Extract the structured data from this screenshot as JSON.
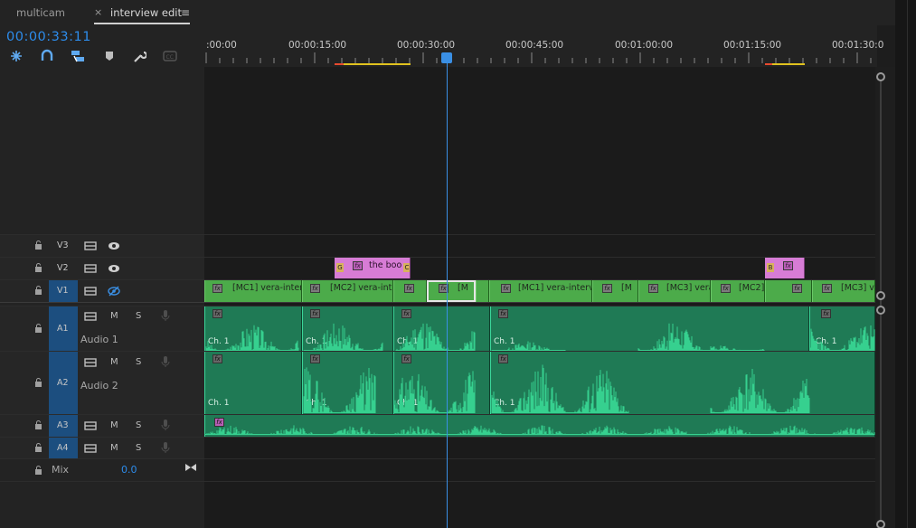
{
  "tabs": {
    "inactive": "multicam",
    "close_glyph": "×",
    "active": "interview edit",
    "menu_glyph": "≡"
  },
  "timecode": "00:00:33:11",
  "toolbar": {
    "icons": [
      "insert-nest-icon",
      "snap-magnet-icon",
      "linked-selection-icon",
      "add-marker-icon",
      "settings-wrench-icon",
      "captions-icon"
    ]
  },
  "ruler": {
    "labels": [
      ":00:00",
      "00:00:15:00",
      "00:00:30:00",
      "00:00:45:00",
      "00:01:00:00",
      "00:01:15:00",
      "00:01:30:0"
    ]
  },
  "tracks": {
    "v3": {
      "name": "V3"
    },
    "v2": {
      "name": "V2"
    },
    "v1": {
      "name": "V1"
    },
    "a1": {
      "name": "A1",
      "label": "Audio 1",
      "m": "M",
      "s": "S"
    },
    "a2": {
      "name": "A2",
      "label": "Audio 2",
      "m": "M",
      "s": "S"
    },
    "a3": {
      "name": "A3",
      "m": "M",
      "s": "S"
    },
    "a4": {
      "name": "A4",
      "m": "M",
      "s": "S"
    },
    "mix": {
      "label": "Mix",
      "value": "0.0"
    }
  },
  "clips": {
    "fx": "fx",
    "v2_label": "the boo",
    "v2_left_marker": "G",
    "v2_right_marker": "C",
    "v2_b_marker": "B",
    "v1": [
      "[MC1] vera-intervi",
      "[MC2] vera-inter",
      "",
      "[M",
      "[MC1] vera-intervie",
      "[M",
      "[MC3] vera",
      "[MC2]",
      "",
      "[MC3] v"
    ],
    "ch": "Ch. 1"
  },
  "colors": {
    "accent_blue": "#2d8ceb",
    "video_clip": "#4cab4a",
    "graphic_clip": "#d77cd5",
    "audio_clip": "#1f7a55",
    "waveform": "#36d08f"
  }
}
